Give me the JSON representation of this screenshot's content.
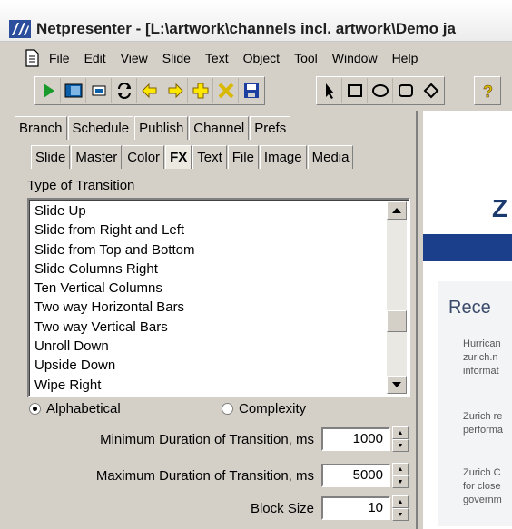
{
  "window": {
    "title": "Netpresenter - [L:\\artwork\\channels incl. artwork\\Demo ja"
  },
  "menu": [
    "File",
    "Edit",
    "View",
    "Slide",
    "Text",
    "Object",
    "Tool",
    "Window",
    "Help"
  ],
  "toolbar": {
    "icons": [
      "play-icon",
      "monitor-icon",
      "slide-icon",
      "refresh-icon",
      "arrow-left-icon",
      "arrow-right-icon",
      "add-icon",
      "delete-icon",
      "save-icon",
      "pointer-icon",
      "rectangle-icon",
      "ellipse-icon",
      "rounded-rect-icon",
      "diamond-icon",
      "help-icon"
    ]
  },
  "tabs_top": [
    "Branch",
    "Schedule",
    "Publish",
    "Channel",
    "Prefs"
  ],
  "tabs_sub": [
    "Slide",
    "Master",
    "Color",
    "FX",
    "Text",
    "File",
    "Image",
    "Media"
  ],
  "active_sub_tab": "FX",
  "transition": {
    "label": "Type of Transition",
    "items": [
      "Slide Up",
      "Slide from Right and Left",
      "Slide from Top and Bottom",
      "Slide Columns Right",
      "Ten Vertical Columns",
      "Two way Horizontal Bars",
      "Two way Vertical Bars",
      "Unroll Down",
      "Upside Down",
      "Wipe Right"
    ]
  },
  "sort": {
    "alphabetical_label": "Alphabetical",
    "complexity_label": "Complexity",
    "selected": "Alphabetical"
  },
  "fields": {
    "min_label": "Minimum Duration of Transition, ms",
    "min_value": "1000",
    "max_label": "Maximum Duration of Transition, ms",
    "max_value": "5000",
    "block_label": "Block Size",
    "block_value": "10"
  },
  "preview": {
    "big_letter": "Z",
    "heading": "Rece",
    "blocks": [
      [
        "Hurrican",
        "zurich.n",
        "informat"
      ],
      [
        "Zurich re",
        "performa"
      ],
      [
        "Zurich C",
        "for close",
        "governm"
      ]
    ]
  }
}
